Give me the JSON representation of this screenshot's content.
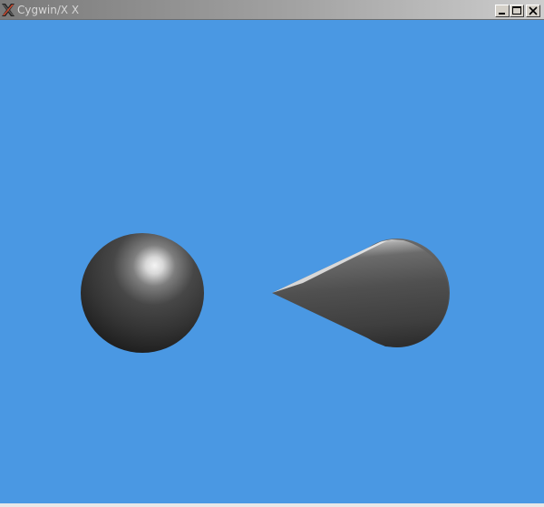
{
  "window": {
    "title": "Cygwin/X X",
    "title_icon": "x-logo-icon",
    "controls": {
      "minimize": "minimize-icon",
      "maximize": "maximize-icon",
      "close": "close-icon"
    }
  },
  "scene": {
    "background_color": "#4a98e3",
    "objects": [
      {
        "shape": "sphere",
        "color": "#3a3a3a"
      },
      {
        "shape": "cone",
        "color": "#5a5a5a"
      }
    ]
  }
}
